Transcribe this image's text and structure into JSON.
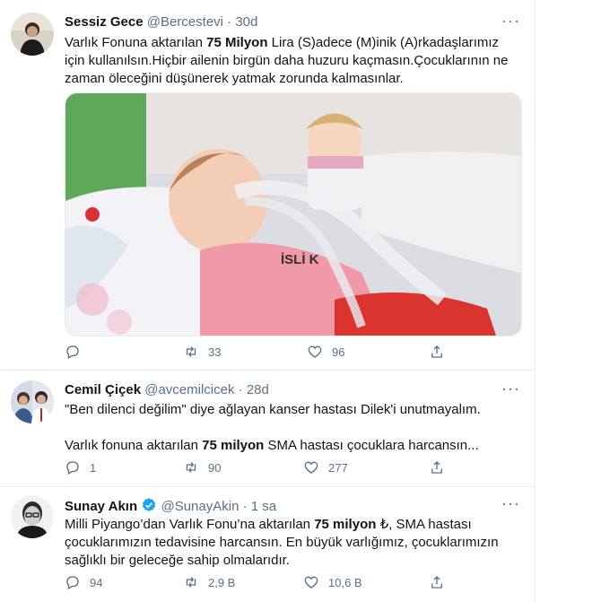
{
  "tweets": [
    {
      "name": "Sessiz Gece",
      "handle": "@Bercestevi",
      "dot": "·",
      "time": "30d",
      "text_1": "Varlık Fonuna aktarılan ",
      "bold_1": "75 Milyon",
      "text_2": " Lira (S)adece (M)inik (A)rkadaşlarımız için kullanılsın.Hiçbir ailenin birgün daha huzuru kaçmasın.Çocuklarının ne zaman öleceğini düşünerek yatmak zorunda kalmasınlar.",
      "replies": "",
      "retweets": "33",
      "likes": "96",
      "media_caption": "İSLİ K"
    },
    {
      "name": "Cemil Çiçek",
      "handle": "@avcemilcicek",
      "dot": "·",
      "time": "28d",
      "line_1": "\"Ben dilenci değilim\" diye ağlayan kanser hastası Dilek'i unutmayalım.",
      "text_1": "Varlık fonuna aktarılan ",
      "bold_1": "75 milyon",
      "text_2": " SMA hastası çocuklara harcansın...",
      "replies": "1",
      "retweets": "90",
      "likes": "277"
    },
    {
      "name": "Sunay Akın",
      "handle": "@SunayAkin",
      "dot": "·",
      "time": "1 sa",
      "text_1": "Milli Piyango’dan Varlık Fonu’na aktarılan ",
      "bold_1": "75 milyon",
      "text_2": " ₺, SMA hastası çocuklarımızın tedavisine harcansın. En büyük varlığımız, çocuklarımızın sağlıklı bir geleceğe sahip olmalarıdır.",
      "replies": "94",
      "retweets": "2,9 B",
      "likes": "10,6 B"
    }
  ],
  "more_label": "···",
  "colors": {
    "verified": "#1da1f2",
    "muted": "#5b7083",
    "divider": "#e6ecf0"
  }
}
